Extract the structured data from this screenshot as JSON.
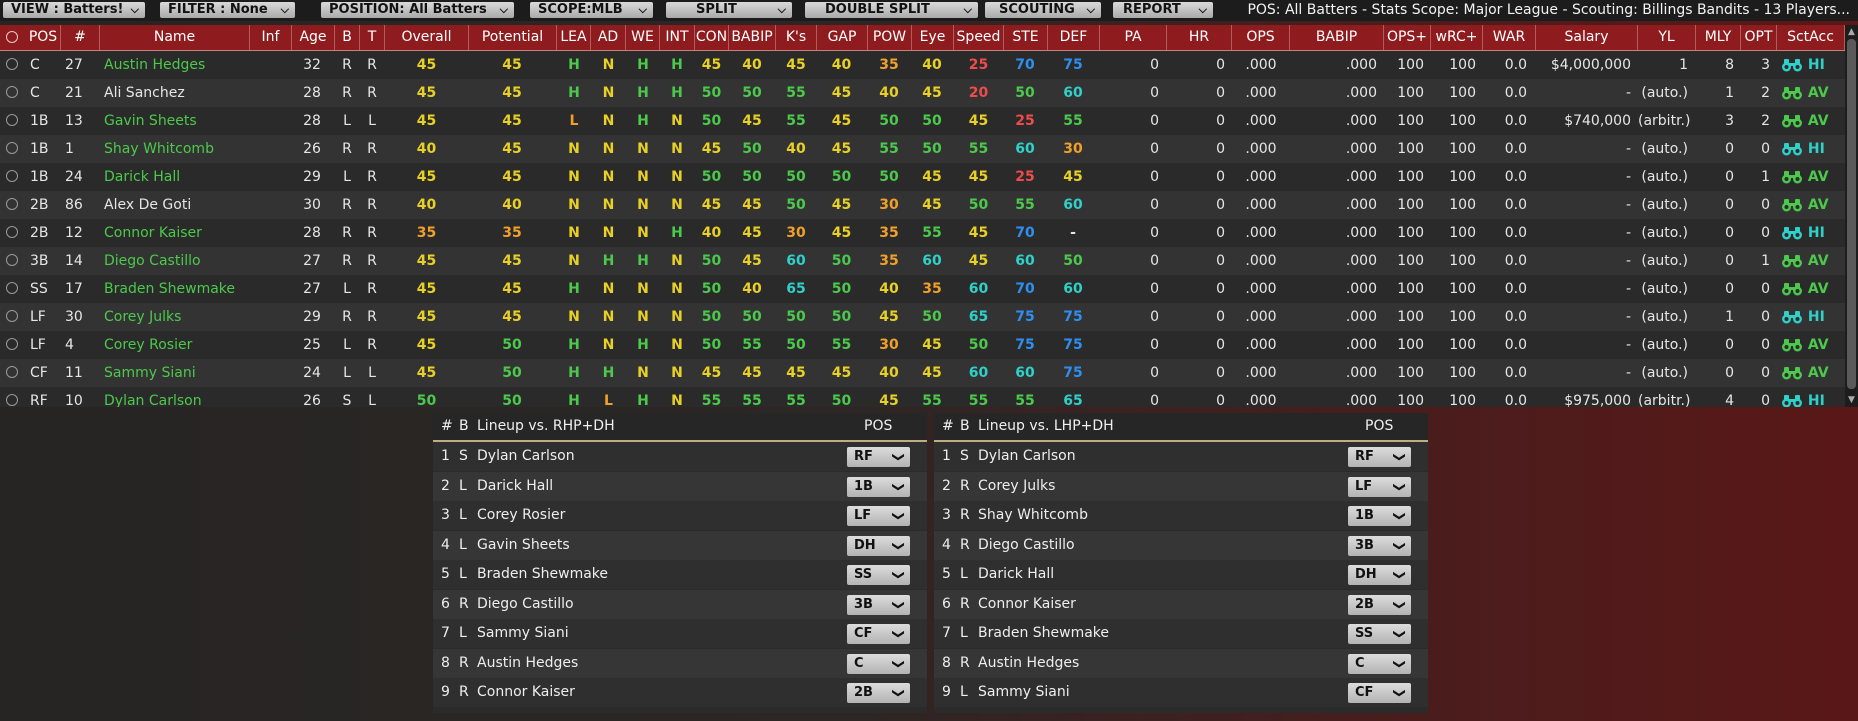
{
  "colors": {
    "green": "#4cc94c",
    "yellow": "#e8d025",
    "orange": "#f0a02a",
    "red": "#ee4c4c",
    "blue": "#2f8ff0",
    "teal": "#2fd0c8",
    "white": "#e6e6e6",
    "header": "#8e1b1e"
  },
  "toolbar": {
    "view": "VIEW : Batters!",
    "filter": "FILTER : None",
    "position": "POSITION: All Batters",
    "scope": "SCOPE:MLB",
    "split": "SPLIT",
    "double_split": "DOUBLE SPLIT",
    "scouting": "SCOUTING",
    "report": "REPORT",
    "status": "POS: All Batters - Stats Scope: Major League - Scouting: Billings Bandits - 13 Players..."
  },
  "columns": [
    "POS",
    "#",
    "Name",
    "Inf",
    "Age",
    "B",
    "T",
    "Overall",
    "Potential",
    "LEA",
    "AD",
    "WE",
    "INT",
    "CON",
    "BABIP",
    "K's",
    "GAP",
    "POW",
    "Eye",
    "Speed",
    "STE",
    "DEF",
    "PA",
    "HR",
    "OPS",
    "BABIP",
    "OPS+",
    "wRC+",
    "WAR",
    "Salary",
    "YL",
    "MLY",
    "OPT",
    "SctAcc"
  ],
  "players": [
    {
      "pos": "C",
      "num": "27",
      "name": "Austin Hedges",
      "name_c": "g",
      "inf": "",
      "age": "32",
      "b": "R",
      "t": "R",
      "ovr": "45",
      "ovr_c": "y",
      "pot": "45",
      "pot_c": "y",
      "lea": "H",
      "lea_c": "g",
      "ad": "N",
      "ad_c": "y",
      "we": "H",
      "we_c": "g",
      "int": "H",
      "int_c": "g",
      "con": "45",
      "con_c": "y",
      "babip": "40",
      "babip_c": "y",
      "ks": "45",
      "ks_c": "y",
      "gap": "40",
      "gap_c": "y",
      "pow": "35",
      "pow_c": "o",
      "eye": "40",
      "eye_c": "y",
      "speed": "25",
      "speed_c": "r",
      "ste": "70",
      "ste_c": "b",
      "def": "75",
      "def_c": "b",
      "pa": "0",
      "hr": "0",
      "ops": ".000",
      "babip2": ".000",
      "opsp": "100",
      "wrc": "100",
      "war": "0.0",
      "salary": "$4,000,000",
      "yl": "1",
      "mly": "8",
      "opt": "3",
      "sa": "HI",
      "bino": "t"
    },
    {
      "pos": "C",
      "num": "21",
      "name": "Ali Sanchez",
      "name_c": "w",
      "inf": "",
      "age": "28",
      "b": "R",
      "t": "R",
      "ovr": "45",
      "ovr_c": "y",
      "pot": "45",
      "pot_c": "y",
      "lea": "H",
      "lea_c": "g",
      "ad": "N",
      "ad_c": "y",
      "we": "H",
      "we_c": "g",
      "int": "H",
      "int_c": "g",
      "con": "50",
      "con_c": "g",
      "babip": "50",
      "babip_c": "g",
      "ks": "55",
      "ks_c": "g",
      "gap": "45",
      "gap_c": "y",
      "pow": "40",
      "pow_c": "y",
      "eye": "45",
      "eye_c": "y",
      "speed": "20",
      "speed_c": "r",
      "ste": "50",
      "ste_c": "g",
      "def": "60",
      "def_c": "t",
      "pa": "0",
      "hr": "0",
      "ops": ".000",
      "babip2": ".000",
      "opsp": "100",
      "wrc": "100",
      "war": "0.0",
      "salary": "-",
      "yl": "(auto.)",
      "mly": "1",
      "opt": "2",
      "sa": "AV",
      "bino": "g"
    },
    {
      "pos": "1B",
      "num": "13",
      "name": "Gavin Sheets",
      "name_c": "g",
      "inf": "",
      "age": "28",
      "b": "L",
      "t": "L",
      "ovr": "45",
      "ovr_c": "y",
      "pot": "45",
      "pot_c": "y",
      "lea": "L",
      "lea_c": "o",
      "ad": "N",
      "ad_c": "y",
      "we": "H",
      "we_c": "g",
      "int": "N",
      "int_c": "y",
      "con": "50",
      "con_c": "g",
      "babip": "45",
      "babip_c": "y",
      "ks": "55",
      "ks_c": "g",
      "gap": "45",
      "gap_c": "y",
      "pow": "50",
      "pow_c": "g",
      "eye": "50",
      "eye_c": "g",
      "speed": "45",
      "speed_c": "y",
      "ste": "25",
      "ste_c": "r",
      "def": "55",
      "def_c": "g",
      "pa": "0",
      "hr": "0",
      "ops": ".000",
      "babip2": ".000",
      "opsp": "100",
      "wrc": "100",
      "war": "0.0",
      "salary": "$740,000",
      "yl": "(arbitr.)",
      "mly": "3",
      "opt": "2",
      "sa": "AV",
      "bino": "g"
    },
    {
      "pos": "1B",
      "num": "1",
      "name": "Shay Whitcomb",
      "name_c": "g",
      "inf": "",
      "age": "26",
      "b": "R",
      "t": "R",
      "ovr": "40",
      "ovr_c": "y",
      "pot": "45",
      "pot_c": "y",
      "lea": "N",
      "lea_c": "y",
      "ad": "N",
      "ad_c": "y",
      "we": "N",
      "we_c": "y",
      "int": "N",
      "int_c": "y",
      "con": "45",
      "con_c": "y",
      "babip": "50",
      "babip_c": "g",
      "ks": "40",
      "ks_c": "y",
      "gap": "45",
      "gap_c": "y",
      "pow": "55",
      "pow_c": "g",
      "eye": "50",
      "eye_c": "g",
      "speed": "55",
      "speed_c": "g",
      "ste": "60",
      "ste_c": "t",
      "def": "30",
      "def_c": "o",
      "pa": "0",
      "hr": "0",
      "ops": ".000",
      "babip2": ".000",
      "opsp": "100",
      "wrc": "100",
      "war": "0.0",
      "salary": "-",
      "yl": "(auto.)",
      "mly": "0",
      "opt": "0",
      "sa": "HI",
      "bino": "t"
    },
    {
      "pos": "1B",
      "num": "24",
      "name": "Darick Hall",
      "name_c": "g",
      "inf": "",
      "age": "29",
      "b": "L",
      "t": "R",
      "ovr": "45",
      "ovr_c": "y",
      "pot": "45",
      "pot_c": "y",
      "lea": "N",
      "lea_c": "y",
      "ad": "N",
      "ad_c": "y",
      "we": "N",
      "we_c": "y",
      "int": "N",
      "int_c": "y",
      "con": "50",
      "con_c": "g",
      "babip": "50",
      "babip_c": "g",
      "ks": "50",
      "ks_c": "g",
      "gap": "50",
      "gap_c": "g",
      "pow": "50",
      "pow_c": "g",
      "eye": "45",
      "eye_c": "y",
      "speed": "45",
      "speed_c": "y",
      "ste": "25",
      "ste_c": "r",
      "def": "45",
      "def_c": "y",
      "pa": "0",
      "hr": "0",
      "ops": ".000",
      "babip2": ".000",
      "opsp": "100",
      "wrc": "100",
      "war": "0.0",
      "salary": "-",
      "yl": "(auto.)",
      "mly": "0",
      "opt": "1",
      "sa": "AV",
      "bino": "g"
    },
    {
      "pos": "2B",
      "num": "86",
      "name": "Alex De Goti",
      "name_c": "w",
      "inf": "",
      "age": "30",
      "b": "R",
      "t": "R",
      "ovr": "40",
      "ovr_c": "y",
      "pot": "40",
      "pot_c": "y",
      "lea": "N",
      "lea_c": "y",
      "ad": "N",
      "ad_c": "y",
      "we": "N",
      "we_c": "y",
      "int": "N",
      "int_c": "y",
      "con": "45",
      "con_c": "y",
      "babip": "45",
      "babip_c": "y",
      "ks": "50",
      "ks_c": "g",
      "gap": "45",
      "gap_c": "y",
      "pow": "30",
      "pow_c": "o",
      "eye": "45",
      "eye_c": "y",
      "speed": "50",
      "speed_c": "g",
      "ste": "55",
      "ste_c": "g",
      "def": "60",
      "def_c": "t",
      "pa": "0",
      "hr": "0",
      "ops": ".000",
      "babip2": ".000",
      "opsp": "100",
      "wrc": "100",
      "war": "0.0",
      "salary": "-",
      "yl": "(auto.)",
      "mly": "0",
      "opt": "0",
      "sa": "AV",
      "bino": "g"
    },
    {
      "pos": "2B",
      "num": "12",
      "name": "Connor Kaiser",
      "name_c": "g",
      "inf": "",
      "age": "28",
      "b": "R",
      "t": "R",
      "ovr": "35",
      "ovr_c": "o",
      "pot": "35",
      "pot_c": "o",
      "lea": "N",
      "lea_c": "y",
      "ad": "N",
      "ad_c": "y",
      "we": "N",
      "we_c": "y",
      "int": "H",
      "int_c": "g",
      "con": "40",
      "con_c": "y",
      "babip": "45",
      "babip_c": "y",
      "ks": "30",
      "ks_c": "o",
      "gap": "45",
      "gap_c": "y",
      "pow": "35",
      "pow_c": "o",
      "eye": "55",
      "eye_c": "g",
      "speed": "45",
      "speed_c": "y",
      "ste": "70",
      "ste_c": "b",
      "def": "-",
      "def_c": "w",
      "pa": "0",
      "hr": "0",
      "ops": ".000",
      "babip2": ".000",
      "opsp": "100",
      "wrc": "100",
      "war": "0.0",
      "salary": "-",
      "yl": "(auto.)",
      "mly": "0",
      "opt": "0",
      "sa": "HI",
      "bino": "t"
    },
    {
      "pos": "3B",
      "num": "14",
      "name": "Diego Castillo",
      "name_c": "g",
      "inf": "",
      "age": "27",
      "b": "R",
      "t": "R",
      "ovr": "45",
      "ovr_c": "y",
      "pot": "45",
      "pot_c": "y",
      "lea": "N",
      "lea_c": "y",
      "ad": "H",
      "ad_c": "g",
      "we": "H",
      "we_c": "g",
      "int": "N",
      "int_c": "y",
      "con": "50",
      "con_c": "g",
      "babip": "45",
      "babip_c": "y",
      "ks": "60",
      "ks_c": "t",
      "gap": "50",
      "gap_c": "g",
      "pow": "35",
      "pow_c": "o",
      "eye": "60",
      "eye_c": "t",
      "speed": "45",
      "speed_c": "y",
      "ste": "60",
      "ste_c": "t",
      "def": "50",
      "def_c": "g",
      "pa": "0",
      "hr": "0",
      "ops": ".000",
      "babip2": ".000",
      "opsp": "100",
      "wrc": "100",
      "war": "0.0",
      "salary": "-",
      "yl": "(auto.)",
      "mly": "0",
      "opt": "1",
      "sa": "AV",
      "bino": "g"
    },
    {
      "pos": "SS",
      "num": "17",
      "name": "Braden Shewmake",
      "name_c": "g",
      "inf": "",
      "age": "27",
      "b": "L",
      "t": "R",
      "ovr": "45",
      "ovr_c": "y",
      "pot": "45",
      "pot_c": "y",
      "lea": "H",
      "lea_c": "g",
      "ad": "N",
      "ad_c": "y",
      "we": "N",
      "we_c": "y",
      "int": "N",
      "int_c": "y",
      "con": "50",
      "con_c": "g",
      "babip": "40",
      "babip_c": "y",
      "ks": "65",
      "ks_c": "t",
      "gap": "50",
      "gap_c": "g",
      "pow": "40",
      "pow_c": "y",
      "eye": "35",
      "eye_c": "o",
      "speed": "60",
      "speed_c": "t",
      "ste": "70",
      "ste_c": "b",
      "def": "60",
      "def_c": "t",
      "pa": "0",
      "hr": "0",
      "ops": ".000",
      "babip2": ".000",
      "opsp": "100",
      "wrc": "100",
      "war": "0.0",
      "salary": "-",
      "yl": "(auto.)",
      "mly": "0",
      "opt": "0",
      "sa": "AV",
      "bino": "g"
    },
    {
      "pos": "LF",
      "num": "30",
      "name": "Corey Julks",
      "name_c": "g",
      "inf": "",
      "age": "29",
      "b": "R",
      "t": "R",
      "ovr": "45",
      "ovr_c": "y",
      "pot": "45",
      "pot_c": "y",
      "lea": "N",
      "lea_c": "y",
      "ad": "N",
      "ad_c": "y",
      "we": "N",
      "we_c": "y",
      "int": "N",
      "int_c": "y",
      "con": "50",
      "con_c": "g",
      "babip": "50",
      "babip_c": "g",
      "ks": "50",
      "ks_c": "g",
      "gap": "50",
      "gap_c": "g",
      "pow": "45",
      "pow_c": "y",
      "eye": "50",
      "eye_c": "g",
      "speed": "65",
      "speed_c": "t",
      "ste": "75",
      "ste_c": "b",
      "def": "75",
      "def_c": "b",
      "pa": "0",
      "hr": "0",
      "ops": ".000",
      "babip2": ".000",
      "opsp": "100",
      "wrc": "100",
      "war": "0.0",
      "salary": "-",
      "yl": "(auto.)",
      "mly": "1",
      "opt": "0",
      "sa": "HI",
      "bino": "t"
    },
    {
      "pos": "LF",
      "num": "4",
      "name": "Corey Rosier",
      "name_c": "g",
      "inf": "",
      "age": "25",
      "b": "L",
      "t": "R",
      "ovr": "45",
      "ovr_c": "y",
      "pot": "50",
      "pot_c": "g",
      "lea": "H",
      "lea_c": "g",
      "ad": "N",
      "ad_c": "y",
      "we": "H",
      "we_c": "g",
      "int": "N",
      "int_c": "y",
      "con": "50",
      "con_c": "g",
      "babip": "55",
      "babip_c": "g",
      "ks": "50",
      "ks_c": "g",
      "gap": "55",
      "gap_c": "g",
      "pow": "30",
      "pow_c": "o",
      "eye": "45",
      "eye_c": "y",
      "speed": "50",
      "speed_c": "g",
      "ste": "75",
      "ste_c": "b",
      "def": "75",
      "def_c": "b",
      "pa": "0",
      "hr": "0",
      "ops": ".000",
      "babip2": ".000",
      "opsp": "100",
      "wrc": "100",
      "war": "0.0",
      "salary": "-",
      "yl": "(auto.)",
      "mly": "0",
      "opt": "0",
      "sa": "AV",
      "bino": "g"
    },
    {
      "pos": "CF",
      "num": "11",
      "name": "Sammy Siani",
      "name_c": "g",
      "inf": "",
      "age": "24",
      "b": "L",
      "t": "L",
      "ovr": "45",
      "ovr_c": "y",
      "pot": "50",
      "pot_c": "g",
      "lea": "H",
      "lea_c": "g",
      "ad": "H",
      "ad_c": "g",
      "we": "N",
      "we_c": "y",
      "int": "N",
      "int_c": "y",
      "con": "45",
      "con_c": "y",
      "babip": "45",
      "babip_c": "y",
      "ks": "45",
      "ks_c": "y",
      "gap": "45",
      "gap_c": "y",
      "pow": "40",
      "pow_c": "y",
      "eye": "45",
      "eye_c": "y",
      "speed": "60",
      "speed_c": "t",
      "ste": "60",
      "ste_c": "t",
      "def": "75",
      "def_c": "b",
      "pa": "0",
      "hr": "0",
      "ops": ".000",
      "babip2": ".000",
      "opsp": "100",
      "wrc": "100",
      "war": "0.0",
      "salary": "-",
      "yl": "(auto.)",
      "mly": "0",
      "opt": "0",
      "sa": "AV",
      "bino": "g"
    },
    {
      "pos": "RF",
      "num": "10",
      "name": "Dylan Carlson",
      "name_c": "g",
      "inf": "",
      "age": "26",
      "b": "S",
      "t": "L",
      "ovr": "50",
      "ovr_c": "g",
      "pot": "50",
      "pot_c": "g",
      "lea": "H",
      "lea_c": "g",
      "ad": "L",
      "ad_c": "o",
      "we": "H",
      "we_c": "g",
      "int": "N",
      "int_c": "y",
      "con": "55",
      "con_c": "g",
      "babip": "55",
      "babip_c": "g",
      "ks": "55",
      "ks_c": "g",
      "gap": "50",
      "gap_c": "g",
      "pow": "45",
      "pow_c": "y",
      "eye": "55",
      "eye_c": "g",
      "speed": "55",
      "speed_c": "g",
      "ste": "55",
      "ste_c": "g",
      "def": "65",
      "def_c": "t",
      "pa": "0",
      "hr": "0",
      "ops": ".000",
      "babip2": ".000",
      "opsp": "100",
      "wrc": "100",
      "war": "0.0",
      "salary": "$975,000",
      "yl": "(arbitr.)",
      "mly": "4",
      "opt": "0",
      "sa": "HI",
      "bino": "t"
    }
  ],
  "lineup_rhp": {
    "header": {
      "num": "#",
      "b": "B",
      "title": "Lineup vs. RHP+DH",
      "pos": "POS"
    },
    "rows": [
      {
        "n": "1",
        "b": "S",
        "name": "Dylan Carlson",
        "pos": "RF"
      },
      {
        "n": "2",
        "b": "L",
        "name": "Darick Hall",
        "pos": "1B"
      },
      {
        "n": "3",
        "b": "L",
        "name": "Corey Rosier",
        "pos": "LF"
      },
      {
        "n": "4",
        "b": "L",
        "name": "Gavin Sheets",
        "pos": "DH"
      },
      {
        "n": "5",
        "b": "L",
        "name": "Braden Shewmake",
        "pos": "SS"
      },
      {
        "n": "6",
        "b": "R",
        "name": "Diego Castillo",
        "pos": "3B"
      },
      {
        "n": "7",
        "b": "L",
        "name": "Sammy Siani",
        "pos": "CF"
      },
      {
        "n": "8",
        "b": "R",
        "name": "Austin Hedges",
        "pos": "C"
      },
      {
        "n": "9",
        "b": "R",
        "name": "Connor Kaiser",
        "pos": "2B"
      }
    ]
  },
  "lineup_lhp": {
    "header": {
      "num": "#",
      "b": "B",
      "title": "Lineup vs. LHP+DH",
      "pos": "POS"
    },
    "rows": [
      {
        "n": "1",
        "b": "S",
        "name": "Dylan Carlson",
        "pos": "RF"
      },
      {
        "n": "2",
        "b": "R",
        "name": "Corey Julks",
        "pos": "LF"
      },
      {
        "n": "3",
        "b": "R",
        "name": "Shay Whitcomb",
        "pos": "1B"
      },
      {
        "n": "4",
        "b": "R",
        "name": "Diego Castillo",
        "pos": "3B"
      },
      {
        "n": "5",
        "b": "L",
        "name": "Darick Hall",
        "pos": "DH"
      },
      {
        "n": "6",
        "b": "R",
        "name": "Connor Kaiser",
        "pos": "2B"
      },
      {
        "n": "7",
        "b": "L",
        "name": "Braden Shewmake",
        "pos": "SS"
      },
      {
        "n": "8",
        "b": "R",
        "name": "Austin Hedges",
        "pos": "C"
      },
      {
        "n": "9",
        "b": "L",
        "name": "Sammy Siani",
        "pos": "CF"
      }
    ]
  },
  "icons": {
    "dropdown": "chevron-down-icon",
    "scout": "binoculars-icon",
    "radio": "radio-icon"
  }
}
